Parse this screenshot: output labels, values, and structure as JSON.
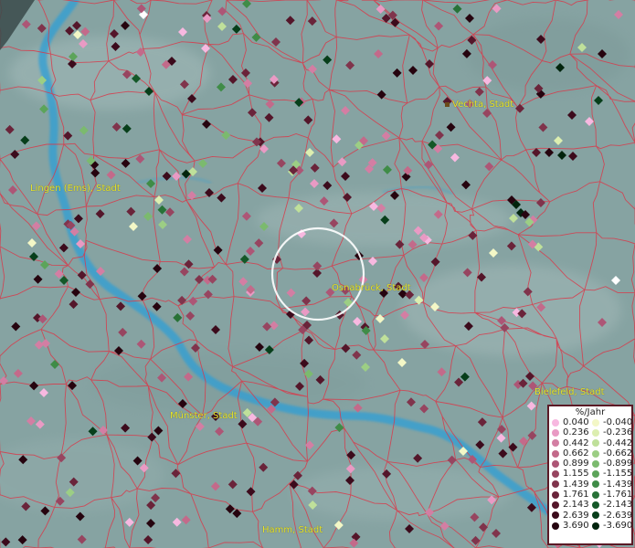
{
  "map": {
    "cities": [
      {
        "name": "Vechta, Stadt"
      },
      {
        "name": "Lingen (Ems), Stadt"
      },
      {
        "name": "Osnabrück, Stadt"
      },
      {
        "name": "Bielefeld, Stadt"
      },
      {
        "name": "Münster, Stadt"
      },
      {
        "name": "Hamm, Stadt"
      }
    ],
    "legend": {
      "title": "%/Jahr",
      "positive": [
        {
          "label": "0.040",
          "color": "#f7b8e0"
        },
        {
          "label": "0.236",
          "color": "#e99ac4"
        },
        {
          "label": "0.442",
          "color": "#d37ea3"
        },
        {
          "label": "0.662",
          "color": "#c36a8a"
        },
        {
          "label": "0.899",
          "color": "#ad5676"
        },
        {
          "label": "1.155",
          "color": "#974560"
        },
        {
          "label": "1.439",
          "color": "#80344c"
        },
        {
          "label": "1.761",
          "color": "#6a243a"
        },
        {
          "label": "2.143",
          "color": "#54162a"
        },
        {
          "label": "2.639",
          "color": "#3c0b1c"
        },
        {
          "label": "3.690",
          "color": "#26040f"
        }
      ],
      "negative": [
        {
          "label": "-0.040",
          "color": "#f3f7c6"
        },
        {
          "label": "-0.236",
          "color": "#dceeb0"
        },
        {
          "label": "-0.442",
          "color": "#bfe09a"
        },
        {
          "label": "-0.662",
          "color": "#9cce84"
        },
        {
          "label": "-0.899",
          "color": "#7bba6e"
        },
        {
          "label": "-1.155",
          "color": "#5ca45a"
        },
        {
          "label": "-1.439",
          "color": "#3f8c47"
        },
        {
          "label": "-1.761",
          "color": "#287237"
        },
        {
          "label": "-2.143",
          "color": "#145828"
        },
        {
          "label": "-2.639",
          "color": "#073e1a"
        },
        {
          "label": "-3.690",
          "color": "#01240d"
        }
      ]
    },
    "colors": {
      "terrain": "#86a3a2",
      "border": "#d83a4a",
      "river": "#2f9fd6",
      "city_label": "#e6e62a",
      "highlight_circle": "#ffffff"
    }
  }
}
